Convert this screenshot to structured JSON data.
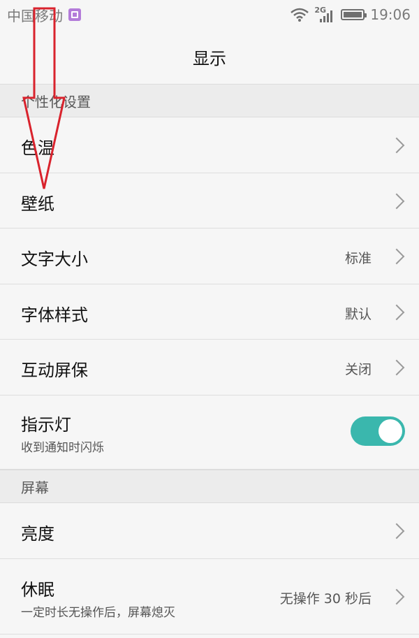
{
  "status_bar": {
    "carrier": "中国移动",
    "network": "2G",
    "time": "19:06"
  },
  "page": {
    "title": "显示"
  },
  "sections": {
    "personalization": {
      "header": "个性化设置"
    },
    "screen": {
      "header": "屏幕"
    }
  },
  "items": {
    "color_temp": {
      "title": "色温"
    },
    "wallpaper": {
      "title": "壁纸"
    },
    "font_size": {
      "title": "文字大小",
      "value": "标准"
    },
    "font_style": {
      "title": "字体样式",
      "value": "默认"
    },
    "screensaver": {
      "title": "互动屏保",
      "value": "关闭"
    },
    "indicator": {
      "title": "指示灯",
      "subtitle": "收到通知时闪烁",
      "enabled": true
    },
    "brightness": {
      "title": "亮度"
    },
    "sleep": {
      "title": "休眠",
      "subtitle": "一定时长无操作后，屏幕熄灭",
      "value": "无操作 30 秒后"
    }
  },
  "colors": {
    "accent": "#3ab7ad",
    "annotation": "#d9232d"
  }
}
